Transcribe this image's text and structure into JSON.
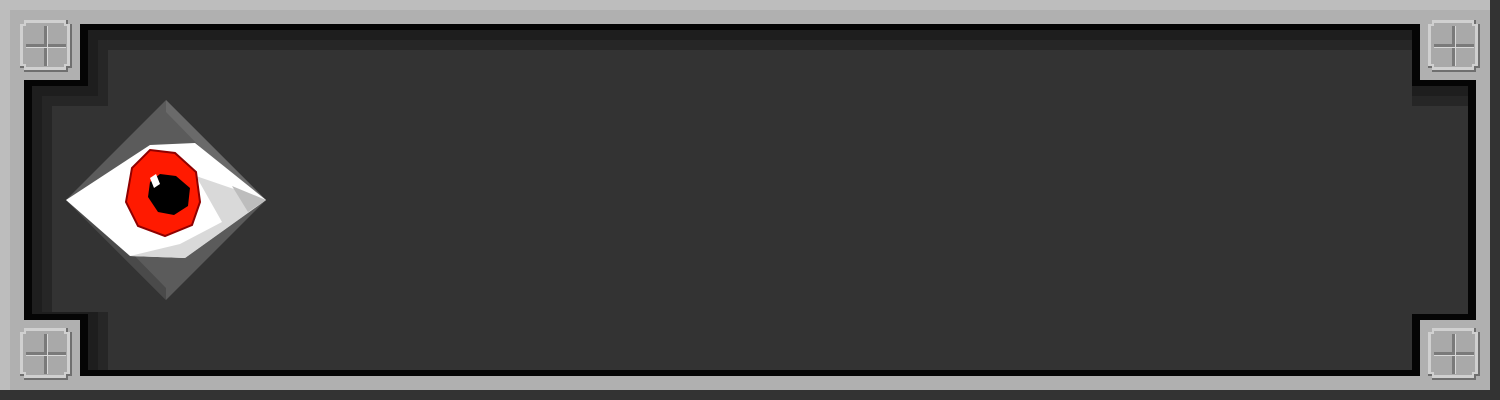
{
  "panel": {
    "frame_color": "#b0b0b0",
    "frame_shadow_color": "#8a8a8a",
    "border_color": "#050505",
    "inner_color": "#333333",
    "bevel_dark": "#1e1e1e",
    "bevel_mid": "#262626"
  },
  "corners": [
    {
      "id": "top-left",
      "icon": "plus-rivet-icon"
    },
    {
      "id": "top-right",
      "icon": "plus-rivet-icon"
    },
    {
      "id": "bottom-left",
      "icon": "plus-rivet-icon"
    },
    {
      "id": "bottom-right",
      "icon": "plus-rivet-icon"
    }
  ],
  "emblem": {
    "icon": "red-eye-icon",
    "sclera_color": "#ffffff",
    "iris_color": "#ff1a00",
    "iris_outline_color": "#8f0000",
    "pupil_color": "#000000",
    "diamond_color": "#5b5b5b"
  },
  "message_text": ""
}
